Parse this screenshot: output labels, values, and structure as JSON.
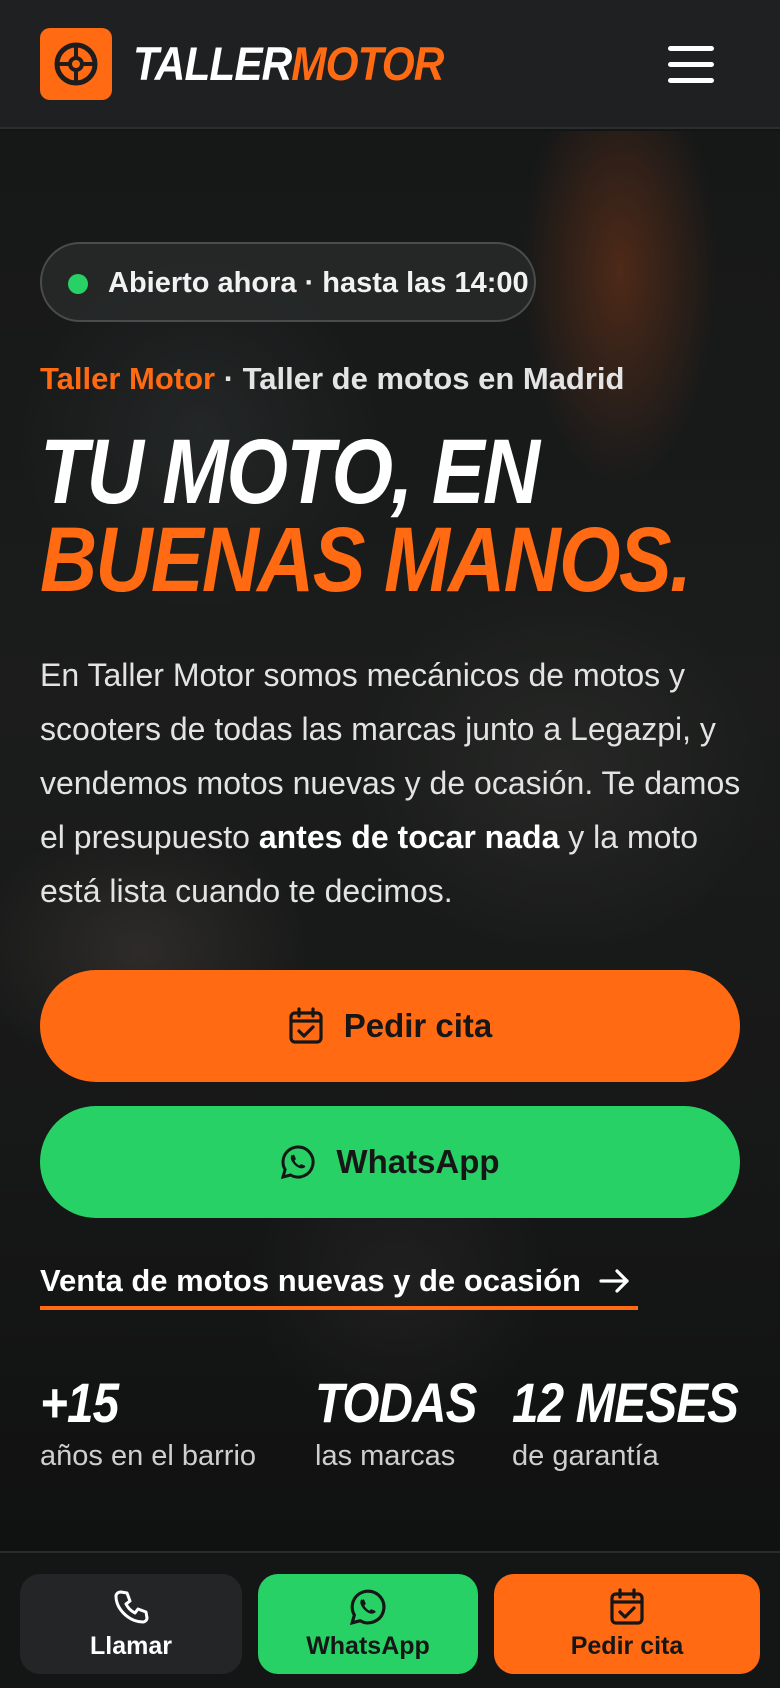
{
  "header": {
    "logo_word_1": "TALLER",
    "logo_word_2": "MOTOR",
    "logo_icon": "steering-wheel-icon",
    "menu_icon": "hamburger-menu-icon"
  },
  "hero": {
    "status": "Abierto ahora · hasta las 14:00",
    "status_color": "#27d165",
    "eyebrow_brand": "Taller Motor",
    "eyebrow_rest": " · Taller de motos en Madrid",
    "headline_line1": "TU MOTO, EN",
    "headline_line2": "BUENAS MANOS.",
    "intro_part1": "En Taller Motor somos mecánicos de motos y scooters de todas las marcas junto a Legazpi, y vendemos motos nuevas y de ocasión. Te damos el presupuesto ",
    "intro_bold": "antes de tocar nada",
    "intro_part2": " y la moto está lista cuando te decimos.",
    "cta_cita": "Pedir cita",
    "cta_whatsapp": "WhatsApp",
    "link_ventas": "Venta de motos nuevas y de ocasión"
  },
  "stats": [
    {
      "value": "+15",
      "caption": "años en el barrio"
    },
    {
      "value": "TODAS",
      "caption": "las marcas"
    },
    {
      "value": "12 MESES",
      "caption": "de garantía"
    }
  ],
  "bottom_bar": {
    "llamar": "Llamar",
    "whatsapp": "WhatsApp",
    "cita": "Pedir cita"
  },
  "colors": {
    "accent": "#ff6a13",
    "whatsapp": "#27d165",
    "header_bg": "#1f2021"
  }
}
